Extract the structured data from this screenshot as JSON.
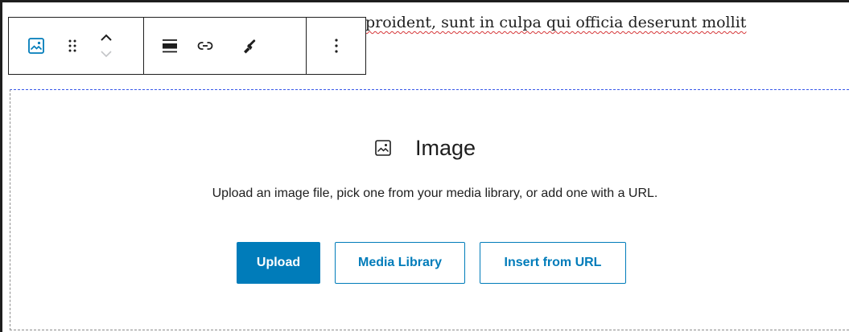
{
  "paragraph": {
    "text": "proident, sunt in culpa qui officia deserunt mollit"
  },
  "toolbar": {
    "block_type_icon": "image-icon",
    "drag_icon": "drag-handle-icon",
    "move_up_icon": "chevron-up-icon",
    "move_down_icon": "chevron-down-icon",
    "align_icon": "align-icon",
    "link_icon": "link-icon",
    "style_icon": "brush-icon",
    "more_icon": "more-vertical-icon"
  },
  "placeholder": {
    "icon": "image-icon",
    "title": "Image",
    "instructions": "Upload an image file, pick one from your media library, or add one with a URL.",
    "buttons": {
      "upload": "Upload",
      "media_library": "Media Library",
      "insert_url": "Insert from URL"
    }
  },
  "colors": {
    "accent": "#007cba",
    "text": "#1e1e1e",
    "spellcheck_underline": "#d63638",
    "selection_outline": "#3858e9"
  }
}
